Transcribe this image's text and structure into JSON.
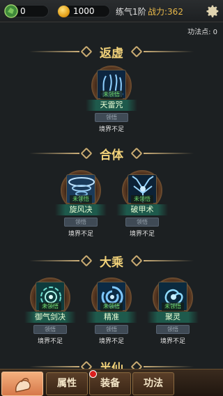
{
  "topbar": {
    "jade_icon": "jade-stone-icon",
    "jade_value": "0",
    "gold_icon": "gold-coin-icon",
    "gold_value": "1000",
    "realm": "练气1阶",
    "power": "战力:362",
    "settings_icon": "gear-icon"
  },
  "points_label": "功法点: 0",
  "tiers": [
    {
      "title": "返虚",
      "skills": [
        {
          "badge": "未领悟",
          "name": "天雷咒",
          "button": "领悟",
          "requirement": "境界不足"
        }
      ]
    },
    {
      "title": "合体",
      "skills": [
        {
          "badge": "未领悟",
          "name": "旋风决",
          "button": "领悟",
          "requirement": "境界不足"
        },
        {
          "badge": "未领悟",
          "name": "破甲术",
          "button": "领悟",
          "requirement": "境界不足"
        }
      ]
    },
    {
      "title": "大乘",
      "skills": [
        {
          "badge": "未领悟",
          "name": "御气剑决",
          "button": "领悟",
          "requirement": "境界不足"
        },
        {
          "badge": "未领悟",
          "name": "精准",
          "button": "领悟",
          "requirement": "境界不足"
        },
        {
          "badge": "未领悟",
          "name": "聚灵",
          "button": "领悟",
          "requirement": "境界不足"
        }
      ]
    },
    {
      "title": "半仙",
      "skills": []
    }
  ],
  "nav": {
    "home_icon": "home-hand-icon",
    "attributes": "属性",
    "equipment": "装备",
    "skills": "功法",
    "notification_icon": "red-dot-icon"
  },
  "colors": {
    "gold_text": "#f3d37a",
    "power_text": "#e9b94a",
    "locked_badge": "#6fe06f",
    "name_band": "#1e5a4c"
  }
}
